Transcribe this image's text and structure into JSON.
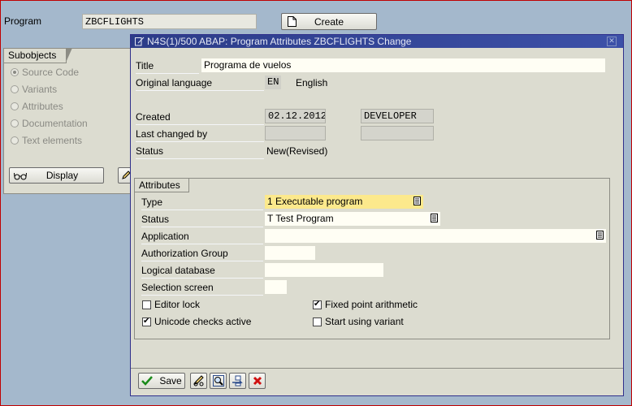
{
  "top": {
    "program_label": "Program",
    "program_value": "ZBCFLIGHTS",
    "create_label": "Create"
  },
  "subobjects": {
    "tab_label": "Subobjects",
    "items": [
      {
        "label": "Source Code",
        "selected": true
      },
      {
        "label": "Variants",
        "selected": false
      },
      {
        "label": "Attributes",
        "selected": false
      },
      {
        "label": "Documentation",
        "selected": false
      },
      {
        "label": "Text elements",
        "selected": false
      }
    ],
    "display_label": "Display"
  },
  "dialog": {
    "title": "N4S(1)/500 ABAP: Program Attributes ZBCFLIGHTS Change",
    "title_label": "Title",
    "title_value": "Programa de vuelos",
    "orig_lang_label": "Original language",
    "orig_lang_code": "EN",
    "orig_lang_name": "English",
    "created_label": "Created",
    "created_date": "02.12.2012",
    "created_by": "DEVELOPER",
    "last_changed_label": "Last changed by",
    "status_label": "Status",
    "status_value": "New(Revised)"
  },
  "attributes": {
    "tab_label": "Attributes",
    "type_label": "Type",
    "type_value": "1 Executable program",
    "status_label": "Status",
    "status_value": "T Test Program",
    "application_label": "Application",
    "application_value": "",
    "auth_group_label": "Authorization Group",
    "logical_db_label": "Logical database",
    "selection_screen_label": "Selection screen",
    "editor_lock_label": "Editor lock",
    "editor_lock_checked": false,
    "fixed_point_label": "Fixed point arithmetic",
    "fixed_point_checked": true,
    "unicode_label": "Unicode checks active",
    "unicode_checked": true,
    "start_variant_label": "Start using variant",
    "start_variant_checked": false
  },
  "toolbar": {
    "save_label": "Save",
    "icons": [
      "check-icon",
      "pencil-glasses-icon",
      "magnifier-icon",
      "transport-icon",
      "cancel-icon"
    ]
  },
  "colors": {
    "desktop": "#a4b8cc",
    "panel": "#dcdcd0",
    "title_bar": "#2c3c88",
    "required_field": "#fce98c"
  }
}
